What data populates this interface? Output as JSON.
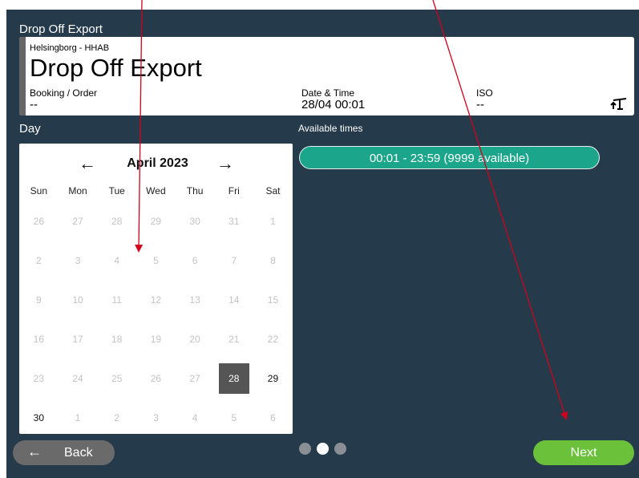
{
  "page": {
    "title": "Drop Off Export"
  },
  "header": {
    "subtitle": "Helsingborg - HHAB",
    "title": "Drop Off Export",
    "booking_label": "Booking / Order",
    "booking_value": "--",
    "datetime_label": "Date & Time",
    "datetime_value": "28/04 00:01",
    "iso_label": "ISO",
    "iso_value": "--",
    "icon": "crane-icon"
  },
  "day_section": {
    "label": "Day"
  },
  "times_section": {
    "label": "Available times"
  },
  "calendar": {
    "month_label": "April 2023",
    "prev_arrow": "←",
    "next_arrow": "→",
    "weekdays": [
      "Sun",
      "Mon",
      "Tue",
      "Wed",
      "Thu",
      "Fri",
      "Sat"
    ],
    "days": [
      {
        "d": "26",
        "s": "disabled"
      },
      {
        "d": "27",
        "s": "disabled"
      },
      {
        "d": "28",
        "s": "disabled"
      },
      {
        "d": "29",
        "s": "disabled"
      },
      {
        "d": "30",
        "s": "disabled"
      },
      {
        "d": "31",
        "s": "disabled"
      },
      {
        "d": "1",
        "s": "disabled"
      },
      {
        "d": "2",
        "s": "disabled"
      },
      {
        "d": "3",
        "s": "disabled"
      },
      {
        "d": "4",
        "s": "disabled"
      },
      {
        "d": "5",
        "s": "disabled"
      },
      {
        "d": "6",
        "s": "disabled"
      },
      {
        "d": "7",
        "s": "disabled"
      },
      {
        "d": "8",
        "s": "disabled"
      },
      {
        "d": "9",
        "s": "disabled"
      },
      {
        "d": "10",
        "s": "disabled"
      },
      {
        "d": "11",
        "s": "disabled"
      },
      {
        "d": "12",
        "s": "disabled"
      },
      {
        "d": "13",
        "s": "disabled"
      },
      {
        "d": "14",
        "s": "disabled"
      },
      {
        "d": "15",
        "s": "disabled"
      },
      {
        "d": "16",
        "s": "disabled"
      },
      {
        "d": "17",
        "s": "disabled"
      },
      {
        "d": "18",
        "s": "disabled"
      },
      {
        "d": "19",
        "s": "disabled"
      },
      {
        "d": "20",
        "s": "disabled"
      },
      {
        "d": "21",
        "s": "disabled"
      },
      {
        "d": "22",
        "s": "disabled"
      },
      {
        "d": "23",
        "s": "disabled"
      },
      {
        "d": "24",
        "s": "disabled"
      },
      {
        "d": "25",
        "s": "disabled"
      },
      {
        "d": "26",
        "s": "disabled"
      },
      {
        "d": "27",
        "s": "disabled"
      },
      {
        "d": "28",
        "s": "selected"
      },
      {
        "d": "29",
        "s": "available"
      },
      {
        "d": "30",
        "s": "available"
      },
      {
        "d": "1",
        "s": "disabled"
      },
      {
        "d": "2",
        "s": "disabled"
      },
      {
        "d": "3",
        "s": "disabled"
      },
      {
        "d": "4",
        "s": "disabled"
      },
      {
        "d": "5",
        "s": "disabled"
      },
      {
        "d": "6",
        "s": "disabled"
      }
    ]
  },
  "time_slots": [
    {
      "label": "00:01 - 23:59 (9999 available)"
    }
  ],
  "footer": {
    "back_arrow": "←",
    "back_label": "Back",
    "next_label": "Next",
    "steps": [
      {
        "active": false
      },
      {
        "active": true
      },
      {
        "active": false
      }
    ]
  },
  "colors": {
    "background": "#253a4b",
    "time_slot": "#1ba68b",
    "next_button": "#6cc13b",
    "back_button": "#6a6a6a",
    "annotation_arrow": "#d0021b"
  }
}
